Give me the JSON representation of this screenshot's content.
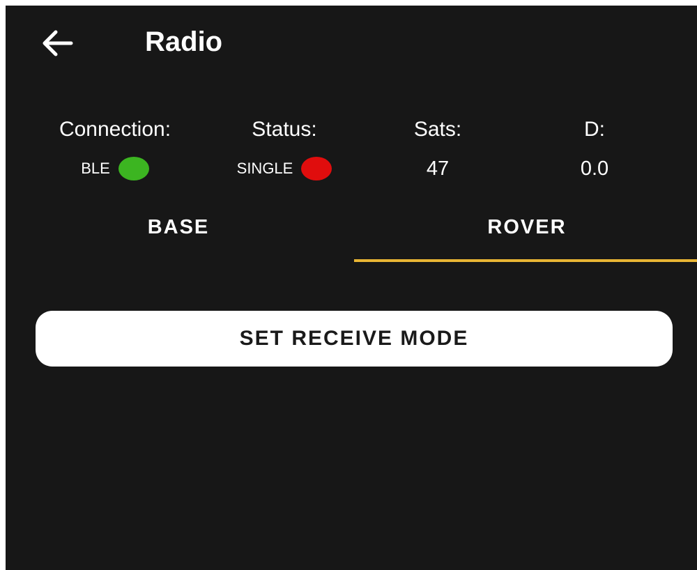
{
  "header": {
    "title": "Radio",
    "back_icon": "arrow-left-icon"
  },
  "stats": {
    "connection": {
      "label": "Connection:",
      "value": "BLE",
      "indicator_color": "#3cb521"
    },
    "status": {
      "label": "Status:",
      "value": "SINGLE",
      "indicator_color": "#e00d0d"
    },
    "sats": {
      "label": "Sats:",
      "value": "47"
    },
    "d": {
      "label": "D:",
      "value": "0.0"
    }
  },
  "tabs": {
    "items": [
      {
        "label": "BASE",
        "selected": false
      },
      {
        "label": "ROVER",
        "selected": true
      }
    ],
    "indicator_color": "#e8b534"
  },
  "action": {
    "label": "SET RECEIVE MODE"
  },
  "colors": {
    "background": "#171717",
    "text": "#ffffff",
    "button_background": "#ffffff",
    "button_text": "#1a1a1a"
  }
}
